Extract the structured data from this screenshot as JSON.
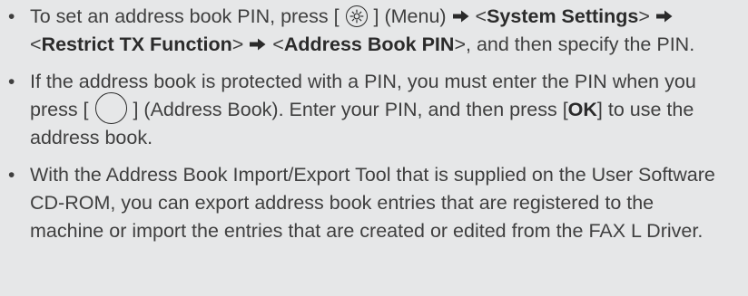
{
  "notes": [
    {
      "p1": "To set an address book PIN, press [ ",
      "menu_key_icon": "menu-key",
      "p2": " ] (Menu) ",
      "lt1": " <",
      "bold1": "System Settings",
      "gt1": "> ",
      "lt2": " <",
      "bold2": "Restrict TX Function",
      "gt2": "> ",
      "lt3": " <",
      "bold3": "Address Book PIN",
      "p3": ">, and then specify the PIN."
    },
    {
      "p1": "If the address book is protected with a PIN, you must enter the PIN when you press [ ",
      "addr_key_icon": "address-book-key",
      "p2": " ] (Address Book). Enter your PIN, and then press [",
      "bold1": "OK",
      "p3": "] to use the address book."
    },
    {
      "text": "With the Address Book Import/Export Tool that is supplied on the User Software CD-ROM, you can export address book entries that are registered to the machine or import the entries that are created or edited from the FAX L Driver."
    }
  ],
  "colors": {
    "background": "#e6e7e8",
    "text": "#3f3f3f"
  }
}
